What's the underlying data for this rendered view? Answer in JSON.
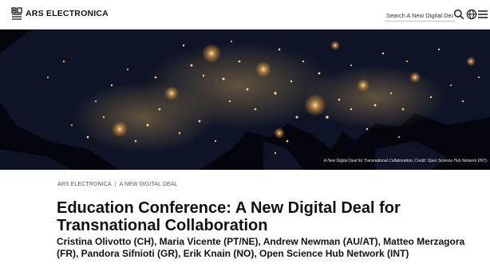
{
  "header": {
    "logo_text": "ARS ELECTRONICA",
    "search_placeholder": "Search A New Digital Dea",
    "icons": [
      "search-icon",
      "globe-icon",
      "menu-icon"
    ]
  },
  "hero": {
    "caption": "A New Digital Deal for Transnational Collaboration, Credit: Open Science Hub Network (INT)"
  },
  "breadcrumb": {
    "items": [
      "ARS ELECTRONICA",
      "A NEW DIGITAL DEAL"
    ],
    "separator": "|"
  },
  "article": {
    "title": "Education Conference: A New Digital Deal for Transnational Collaboration",
    "authors": "Cristina Olivotto (CH), Maria Vicente (PT/NE), Andrew Newman (AU/AT), Matteo Merzagora (FR), Pandora Sifnioti (GR), Erik Knain (NO), Open Science Hub Network (INT)"
  },
  "colors": {
    "hero_background": "#05060d",
    "city_light": "#ffd98a",
    "text": "#111111"
  }
}
